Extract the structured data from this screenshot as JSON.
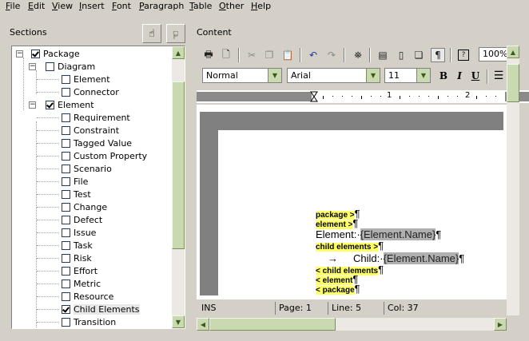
{
  "menu": [
    "File",
    "Edit",
    "View",
    "Insert",
    "Font",
    "Paragraph",
    "Table",
    "Other",
    "Help"
  ],
  "sections": {
    "label": "Sections",
    "tree": [
      {
        "label": "Package",
        "checked": true
      },
      {
        "label": "Diagram",
        "checked": false
      },
      {
        "label": "Element",
        "checked": false
      },
      {
        "label": "Connector",
        "checked": false
      },
      {
        "label": "Element",
        "checked": true
      },
      {
        "label": "Requirement",
        "checked": false
      },
      {
        "label": "Constraint",
        "checked": false
      },
      {
        "label": "Tagged Value",
        "checked": false
      },
      {
        "label": "Custom Property",
        "checked": false
      },
      {
        "label": "Scenario",
        "checked": false
      },
      {
        "label": "File",
        "checked": false
      },
      {
        "label": "Test",
        "checked": false
      },
      {
        "label": "Change",
        "checked": false
      },
      {
        "label": "Defect",
        "checked": false
      },
      {
        "label": "Issue",
        "checked": false
      },
      {
        "label": "Task",
        "checked": false
      },
      {
        "label": "Risk",
        "checked": false
      },
      {
        "label": "Effort",
        "checked": false
      },
      {
        "label": "Metric",
        "checked": false
      },
      {
        "label": "Resource",
        "checked": false
      },
      {
        "label": "Child Elements",
        "checked": true
      },
      {
        "label": "Transition",
        "checked": false
      }
    ]
  },
  "content": {
    "label": "Content",
    "zoom": "100%",
    "style": "Normal",
    "font": "Arial",
    "size": "11",
    "ruler": {
      "mark1": "1",
      "mark2": "2"
    },
    "doc": {
      "package_open": "package >",
      "element_open": "element >",
      "element_label": "Element:",
      "element_field": "{Element.Name}",
      "child_open": "child elements >",
      "child_label": "Child:",
      "child_field": "{Element.Name}",
      "child_close": "< child elements",
      "element_close": "< element",
      "package_close": "< package",
      "pilcrow": "¶",
      "tab_arrow": "→"
    }
  },
  "status": {
    "mode": "INS",
    "page": "Page: 1",
    "line": "Line: 5",
    "col": "Col: 37"
  }
}
